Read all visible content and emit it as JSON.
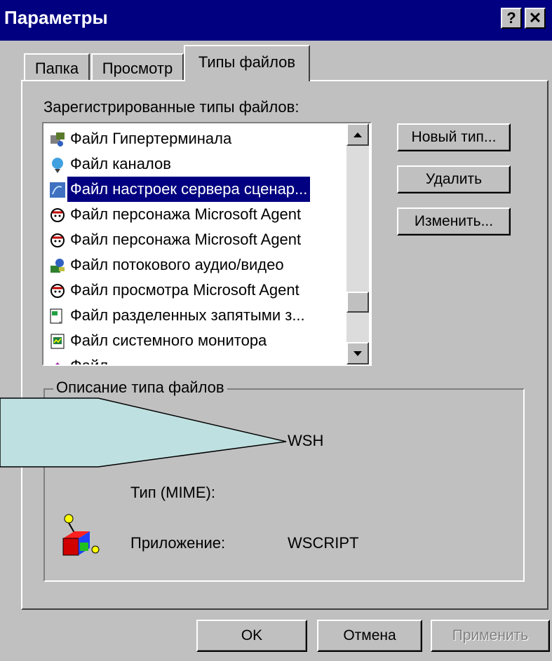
{
  "window": {
    "title": "Параметры",
    "help_btn": "?",
    "close_btn": "✕"
  },
  "tabs": [
    {
      "label": "Папка",
      "active": false
    },
    {
      "label": "Просмотр",
      "active": false
    },
    {
      "label": "Типы файлов",
      "active": true
    }
  ],
  "registered": {
    "label": "Зарегистрированные типы файлов:",
    "items": [
      {
        "label": "Файл Гипертерминала",
        "icon": "hyperterminal-icon",
        "selected": false
      },
      {
        "label": "Файл каналов",
        "icon": "channels-icon",
        "selected": false
      },
      {
        "label": "Файл настроек сервера сценар...",
        "icon": "script-server-icon",
        "selected": true
      },
      {
        "label": "Файл персонажа Microsoft Agent",
        "icon": "agent-character-icon",
        "selected": false
      },
      {
        "label": "Файл персонажа Microsoft Agent",
        "icon": "agent-character-icon",
        "selected": false
      },
      {
        "label": "Файл потокового аудио/видео",
        "icon": "streaming-media-icon",
        "selected": false
      },
      {
        "label": "Файл просмотра Microsoft Agent",
        "icon": "agent-preview-icon",
        "selected": false
      },
      {
        "label": "Файл разделенных запятыми з...",
        "icon": "csv-icon",
        "selected": false
      },
      {
        "label": "Файл системного монитора",
        "icon": "system-monitor-icon",
        "selected": false
      },
      {
        "label": "Файл",
        "icon": "file-icon",
        "selected": false
      }
    ]
  },
  "buttons": {
    "new_type": "Новый тип...",
    "delete": "Удалить",
    "edit": "Изменить...",
    "ok": "OK",
    "cancel": "Отмена",
    "apply": "Применить"
  },
  "description": {
    "legend": "Описание типа файлов",
    "extension_value": "WSH",
    "mime_label": "Тип (MIME):",
    "app_label": "Приложение:",
    "app_value": "WSCRIPT"
  },
  "colors": {
    "titlebar": "#000080",
    "face": "#c0c0c0",
    "selection": "#000080",
    "callout_fill": "#bfe0e0"
  }
}
